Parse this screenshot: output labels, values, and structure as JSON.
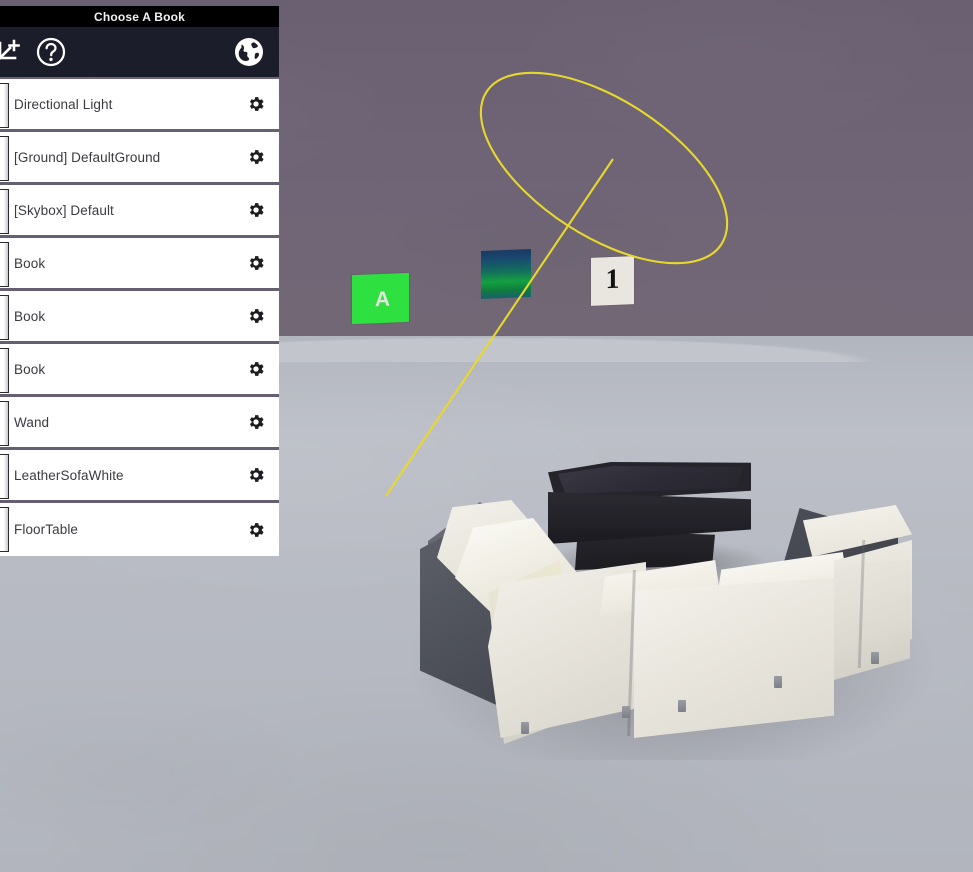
{
  "app": {
    "title": "Choose A Book"
  },
  "toolbar": {
    "add_icon": "add-object-icon",
    "help_icon": "help-question-icon",
    "world_icon": "globe-world-icon"
  },
  "object_list": {
    "gear_icon": "gear-icon",
    "handle_icon": "drag-handle",
    "items": [
      {
        "label": "Directional Light"
      },
      {
        "label": "[Ground] DefaultGround"
      },
      {
        "label": "[Skybox] Default"
      },
      {
        "label": "Book"
      },
      {
        "label": "Book"
      },
      {
        "label": "Book"
      },
      {
        "label": "Wand"
      },
      {
        "label": "LeatherSofaWhite"
      },
      {
        "label": "FloorTable"
      }
    ]
  },
  "scene": {
    "wall_color": "#6e6475",
    "floor_color": "#b9bcc4",
    "laser_color": "#e8d82e",
    "panels": [
      {
        "name": "green-letter-panel",
        "text": "A",
        "color": "#2fe140",
        "text_color": "#e4e6dd"
      },
      {
        "name": "gradient-panel",
        "text": "",
        "color": "#14a040",
        "text_color": ""
      },
      {
        "name": "numbered-panel",
        "text": "1",
        "color": "#e8e6df",
        "text_color": "#131313"
      }
    ],
    "objects": [
      {
        "name": "leather-sofa-white",
        "color": "#eceadf"
      },
      {
        "name": "floor-table",
        "color": "#25242b"
      }
    ]
  }
}
